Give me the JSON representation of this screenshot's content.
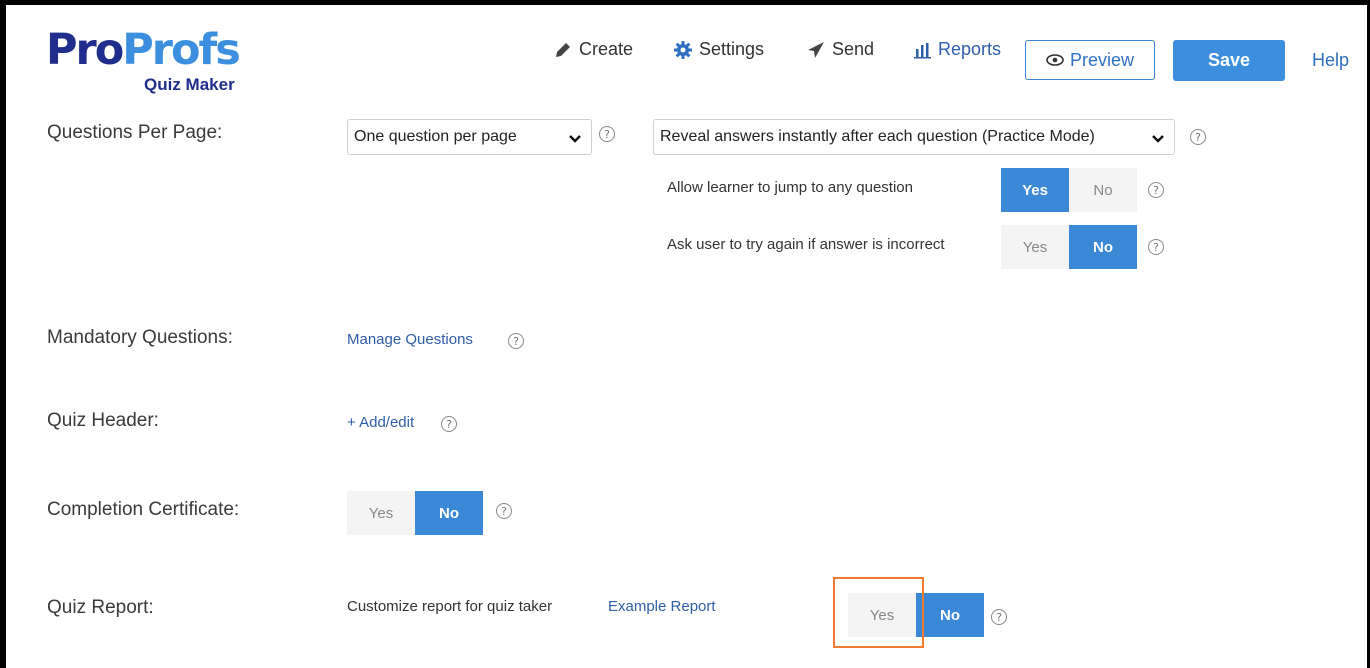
{
  "brand": {
    "name_part1": "Pro",
    "name_part2": "Profs",
    "product": "Quiz Maker"
  },
  "toolbar": {
    "create_label": "Create",
    "settings_label": "Settings",
    "send_label": "Send",
    "reports_label": "Reports",
    "preview_label": "Preview",
    "save_label": "Save",
    "help_label": "Help"
  },
  "questions_per_page": {
    "label": "Questions Per Page:",
    "select_value": "One question per page",
    "reveal_select_value": "Reveal answers instantly after each question (Practice Mode)",
    "jump_label": "Allow learner to jump to any question",
    "jump_yes": "Yes",
    "jump_no": "No",
    "jump_selected": "Yes",
    "retry_label": "Ask user to try again if answer is incorrect",
    "retry_yes": "Yes",
    "retry_no": "No",
    "retry_selected": "No"
  },
  "mandatory": {
    "label": "Mandatory Questions:",
    "link": "Manage Questions"
  },
  "header": {
    "label": "Quiz Header:",
    "link": "+ Add/edit"
  },
  "certificate": {
    "label": "Completion Certificate:",
    "yes": "Yes",
    "no": "No",
    "selected": "No"
  },
  "report": {
    "label": "Quiz Report:",
    "description": "Customize report for quiz taker",
    "link": "Example Report",
    "yes": "Yes",
    "no": "No",
    "selected": "No"
  },
  "help_glyph": "?",
  "colors": {
    "accent": "#3a88d6",
    "brand_dark": "#1f2d8c",
    "brand_light": "#3b8fde",
    "highlight": "#f07a2e"
  }
}
